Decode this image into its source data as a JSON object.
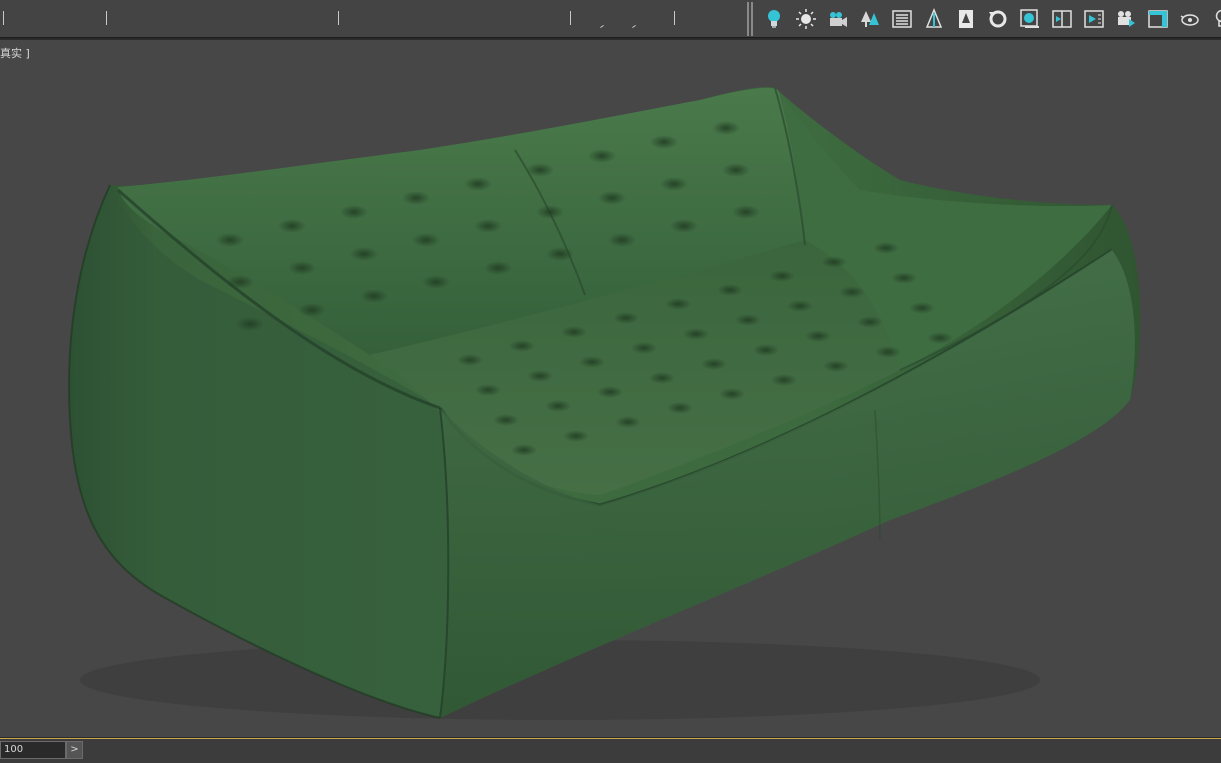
{
  "viewport": {
    "label": "真实 ]",
    "background": "#474747"
  },
  "toolbar": {
    "accent": "#2fb6c8",
    "tools": [
      {
        "icon": "lightbulb-icon"
      },
      {
        "icon": "sun-light-icon"
      },
      {
        "icon": "camera-icon"
      },
      {
        "icon": "trees-icon"
      },
      {
        "icon": "list-panel-icon"
      },
      {
        "icon": "pine-tree-icon"
      },
      {
        "icon": "document-tree-icon"
      },
      {
        "icon": "rotate-icon"
      },
      {
        "icon": "material-editor-icon"
      },
      {
        "icon": "render-frame-icon"
      },
      {
        "icon": "render-setup-icon"
      },
      {
        "icon": "render-production-icon"
      },
      {
        "icon": "viewport-window-icon"
      },
      {
        "icon": "eye-teapot-icon"
      },
      {
        "icon": "bulb-outline-icon"
      }
    ]
  },
  "timeline": {
    "frame_value": "100",
    "next_label": ">"
  },
  "model": {
    "name": "green-leather-sofa",
    "color": "#3f6b40"
  }
}
